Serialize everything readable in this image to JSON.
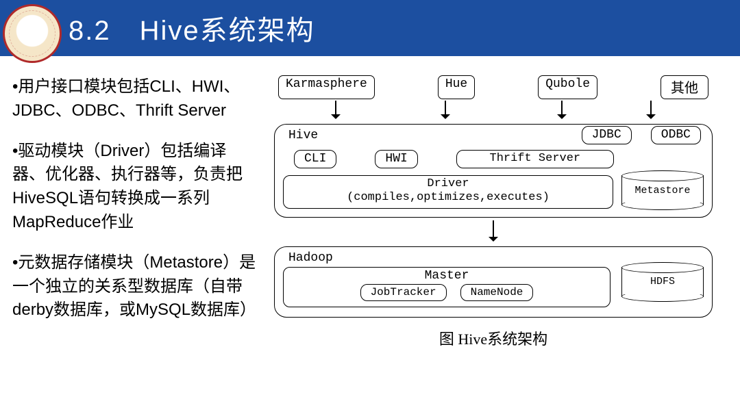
{
  "header": {
    "title": "8.2 Hive系统架构"
  },
  "logo_alt": "校徽",
  "left": {
    "b1": "•用户接口模块包括CLI、HWI、JDBC、ODBC、Thrift Server",
    "b2": "•驱动模块（Driver）包括编译器、优化器、执行器等，负责把HiveSQL语句转换成一系列MapReduce作业",
    "b3": "•元数据存储模块（Metastore）是一个独立的关系型数据库（自带derby数据库，或MySQL数据库）"
  },
  "diagram": {
    "top": [
      "Karmasphere",
      "Hue",
      "Qubole",
      "其他"
    ],
    "hive_label": "Hive",
    "jdbc": "JDBC",
    "odbc": "ODBC",
    "cli": "CLI",
    "hwi": "HWI",
    "thrift": "Thrift Server",
    "driver_line1": "Driver",
    "driver_line2": "(compiles,optimizes,executes)",
    "metastore": "Metastore",
    "hadoop_label": "Hadoop",
    "master_label": "Master",
    "jobtracker": "JobTracker",
    "namenode": "NameNode",
    "hdfs": "HDFS",
    "caption": "图  Hive系统架构"
  }
}
